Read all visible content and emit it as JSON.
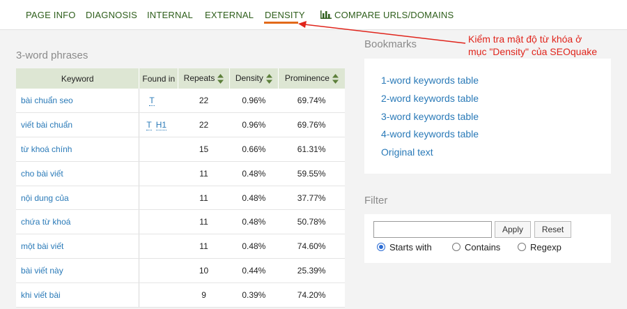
{
  "nav": {
    "page_info": "PAGE INFO",
    "diagnosis": "DIAGNOSIS",
    "internal": "INTERNAL",
    "external": "EXTERNAL",
    "density": "DENSITY",
    "compare": "COMPARE URLS/DOMAINS",
    "active": "DENSITY"
  },
  "phrases": {
    "title": "3-word phrases",
    "columns": [
      "Keyword",
      "Found in",
      "Repeats",
      "Density",
      "Prominence"
    ],
    "rows": [
      {
        "keyword": "bài chuẩn seo",
        "found": [
          "T"
        ],
        "repeats": "22",
        "density": "0.96%",
        "prominence": "69.74%"
      },
      {
        "keyword": "viết bài chuẩn",
        "found": [
          "T",
          "H1"
        ],
        "repeats": "22",
        "density": "0.96%",
        "prominence": "69.76%"
      },
      {
        "keyword": "từ khoá chính",
        "found": [],
        "repeats": "15",
        "density": "0.66%",
        "prominence": "61.31%"
      },
      {
        "keyword": "cho bài viết",
        "found": [],
        "repeats": "11",
        "density": "0.48%",
        "prominence": "59.55%"
      },
      {
        "keyword": "nội dung của",
        "found": [],
        "repeats": "11",
        "density": "0.48%",
        "prominence": "37.77%"
      },
      {
        "keyword": "chứa từ khoá",
        "found": [],
        "repeats": "11",
        "density": "0.48%",
        "prominence": "50.78%"
      },
      {
        "keyword": "một bài viết",
        "found": [],
        "repeats": "11",
        "density": "0.48%",
        "prominence": "74.60%"
      },
      {
        "keyword": "bài viết này",
        "found": [],
        "repeats": "10",
        "density": "0.44%",
        "prominence": "25.39%"
      },
      {
        "keyword": "khi viết bài",
        "found": [],
        "repeats": "9",
        "density": "0.39%",
        "prominence": "74.20%"
      }
    ]
  },
  "bookmarks": {
    "title": "Bookmarks",
    "links": [
      "1-word keywords table",
      "2-word keywords table",
      "3-word keywords table",
      "4-word keywords table",
      "Original text"
    ]
  },
  "filter": {
    "title": "Filter",
    "input_value": "",
    "apply": "Apply",
    "reset": "Reset",
    "options": [
      "Starts with",
      "Contains",
      "Regexp"
    ],
    "selected": "Starts with"
  },
  "annotation": {
    "line1": "Kiểm tra mật độ từ khóa ở",
    "line2": "mục \"Density\" của SEOquake"
  },
  "colors": {
    "nav_text": "#2e5e1b",
    "active_underline": "#e26a1a",
    "link": "#2a7ab8",
    "header_bg": "#dde6d3",
    "annotation": "#e0241b"
  }
}
